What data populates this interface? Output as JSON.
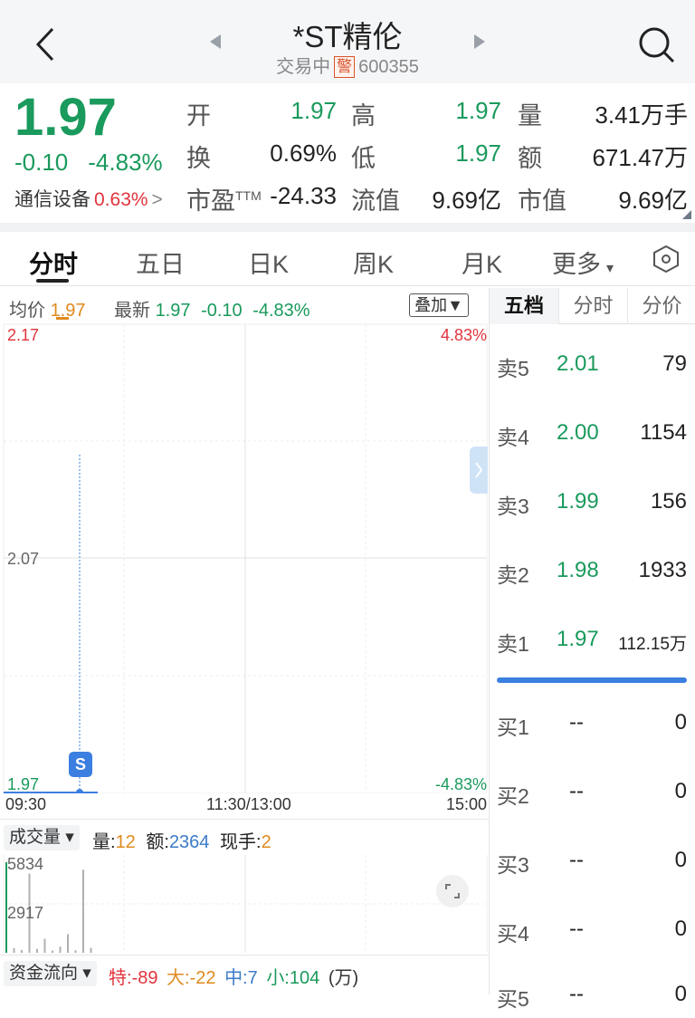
{
  "header": {
    "title": "*ST精伦",
    "status": "交易中",
    "warn_badge": "警",
    "code": "600355"
  },
  "quote": {
    "price": "1.97",
    "change": "-0.10",
    "change_pct": "-4.83%",
    "sector_name": "通信设备",
    "sector_pct": "0.63%",
    "sector_arrow": ">",
    "stats": [
      {
        "label": "开",
        "value": "1.97",
        "color": "#1a9a5c"
      },
      {
        "label": "高",
        "value": "1.97",
        "color": "#1a9a5c"
      },
      {
        "label": "量",
        "value": "3.41万手",
        "color": "#222222"
      },
      {
        "label": "换",
        "value": "0.69%",
        "color": "#222222"
      },
      {
        "label": "低",
        "value": "1.97",
        "color": "#1a9a5c"
      },
      {
        "label": "额",
        "value": "671.47万",
        "color": "#222222"
      },
      {
        "label": "市盈",
        "label_sup": "TTM",
        "value": "-24.33",
        "color": "#222222"
      },
      {
        "label": "流值",
        "value": "9.69亿",
        "color": "#222222"
      },
      {
        "label": "市值",
        "value": "9.69亿",
        "color": "#222222"
      }
    ]
  },
  "tabs": [
    {
      "label": "分时",
      "active": true
    },
    {
      "label": "五日"
    },
    {
      "label": "日K"
    },
    {
      "label": "周K"
    },
    {
      "label": "月K"
    },
    {
      "label": "更多",
      "caret": "▾"
    }
  ],
  "info": {
    "avg_label": "均价",
    "avg_value": "1.97",
    "latest_label": "最新",
    "latest_value": "1.97",
    "latest_change": "-0.10",
    "latest_pct": "-4.83%",
    "overlay_label": "叠加▼"
  },
  "chart_data": {
    "type": "line",
    "y_ticks_left": [
      "2.17",
      "2.07",
      "1.97"
    ],
    "y_ticks_right": [
      "4.83%",
      "-4.83%"
    ],
    "x_ticks": [
      "09:30",
      "11:30/13:00",
      "15:00"
    ],
    "ylim": [
      1.97,
      2.17
    ],
    "series": [
      {
        "values": [
          1.97,
          1.97
        ]
      }
    ],
    "marker_label": "S"
  },
  "volume": {
    "dropdown_label": "成交量 ▾",
    "vol_label": "量:",
    "vol_value": "12",
    "amt_label": "额:",
    "amt_value": "2364",
    "hand_label": "现手:",
    "hand_value": "2",
    "y_ticks": [
      "5834",
      "2917"
    ],
    "bars": [
      5834,
      300,
      180,
      5100,
      250,
      900,
      140,
      400,
      1200,
      160,
      5350,
      320
    ]
  },
  "flow": {
    "dropdown_label": "资金流向 ▾",
    "items": [
      {
        "label": "特:",
        "value": "-89",
        "color": "#e0343c"
      },
      {
        "label": "大:",
        "value": "-22",
        "color": "#e08a1e"
      },
      {
        "label": "中:",
        "value": "7",
        "color": "#3b7bc8"
      },
      {
        "label": "小:",
        "value": "104",
        "color": "#1a9a5c"
      }
    ],
    "unit": "(万)"
  },
  "book": {
    "tabs": [
      "五档",
      "分时",
      "分价"
    ],
    "asks": [
      {
        "name": "卖5",
        "price": "2.01",
        "vol": "79"
      },
      {
        "name": "卖4",
        "price": "2.00",
        "vol": "1154"
      },
      {
        "name": "卖3",
        "price": "1.99",
        "vol": "156"
      },
      {
        "name": "卖2",
        "price": "1.98",
        "vol": "1933"
      },
      {
        "name": "卖1",
        "price": "1.97",
        "vol": "112.15万"
      }
    ],
    "bids": [
      {
        "name": "买1",
        "price": "--",
        "vol": "0"
      },
      {
        "name": "买2",
        "price": "--",
        "vol": "0"
      },
      {
        "name": "买3",
        "price": "--",
        "vol": "0"
      },
      {
        "name": "买4",
        "price": "--",
        "vol": "0"
      },
      {
        "name": "买5",
        "price": "--",
        "vol": "0"
      }
    ]
  }
}
